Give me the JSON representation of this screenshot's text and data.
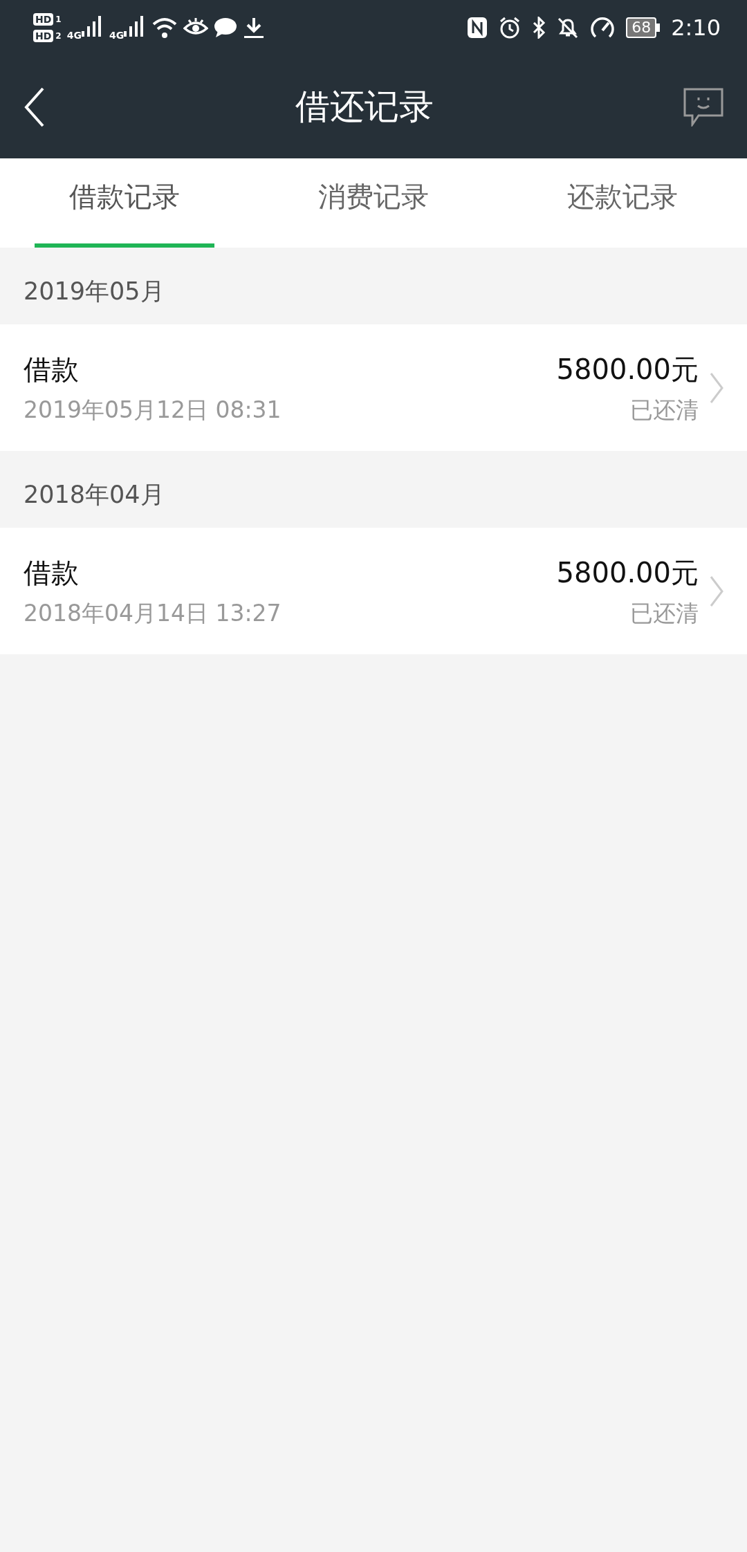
{
  "status_bar": {
    "sims": [
      {
        "hd": "HD",
        "slot": "1",
        "net": "4G"
      },
      {
        "hd": "HD",
        "slot": "2",
        "net": "4G"
      }
    ],
    "battery": "68",
    "time": "2:10"
  },
  "header": {
    "title": "借还记录"
  },
  "tabs": [
    {
      "label": "借款记录",
      "selected": true
    },
    {
      "label": "消费记录",
      "selected": false
    },
    {
      "label": "还款记录",
      "selected": false
    }
  ],
  "sections": [
    {
      "month": "2019年05月",
      "records": [
        {
          "title": "借款",
          "time": "2019年05月12日 08:31",
          "amount": "5800.00元",
          "status": "已还清"
        }
      ]
    },
    {
      "month": "2018年04月",
      "records": [
        {
          "title": "借款",
          "time": "2018年04月14日 13:27",
          "amount": "5800.00元",
          "status": "已还清"
        }
      ]
    }
  ]
}
